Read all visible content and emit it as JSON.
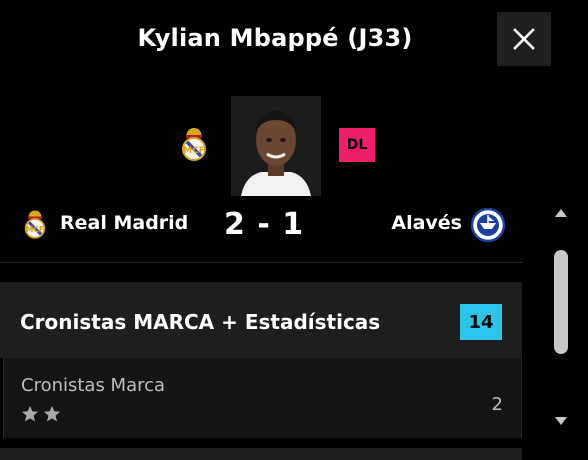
{
  "header": {
    "title": "Kylian Mbappé (J33)",
    "close_icon": "close-icon"
  },
  "player": {
    "club_crest": "real-madrid-crest",
    "photo": "player-photo",
    "position": "DL",
    "position_color": "#ee1f6a"
  },
  "match": {
    "home_team": "Real Madrid",
    "home_crest": "real-madrid-crest",
    "score": "2 - 1",
    "away_team": "Alavés",
    "away_crest": "alaves-crest"
  },
  "ratings": {
    "section_title": "Cronistas MARCA + Estadísticas",
    "total": "14",
    "total_color": "#2ec4ea",
    "items": [
      {
        "label": "Cronistas Marca",
        "stars": 2,
        "value": "2"
      }
    ]
  },
  "scrollbar": {
    "up_icon": "scroll-up-icon",
    "down_icon": "scroll-down-icon"
  }
}
